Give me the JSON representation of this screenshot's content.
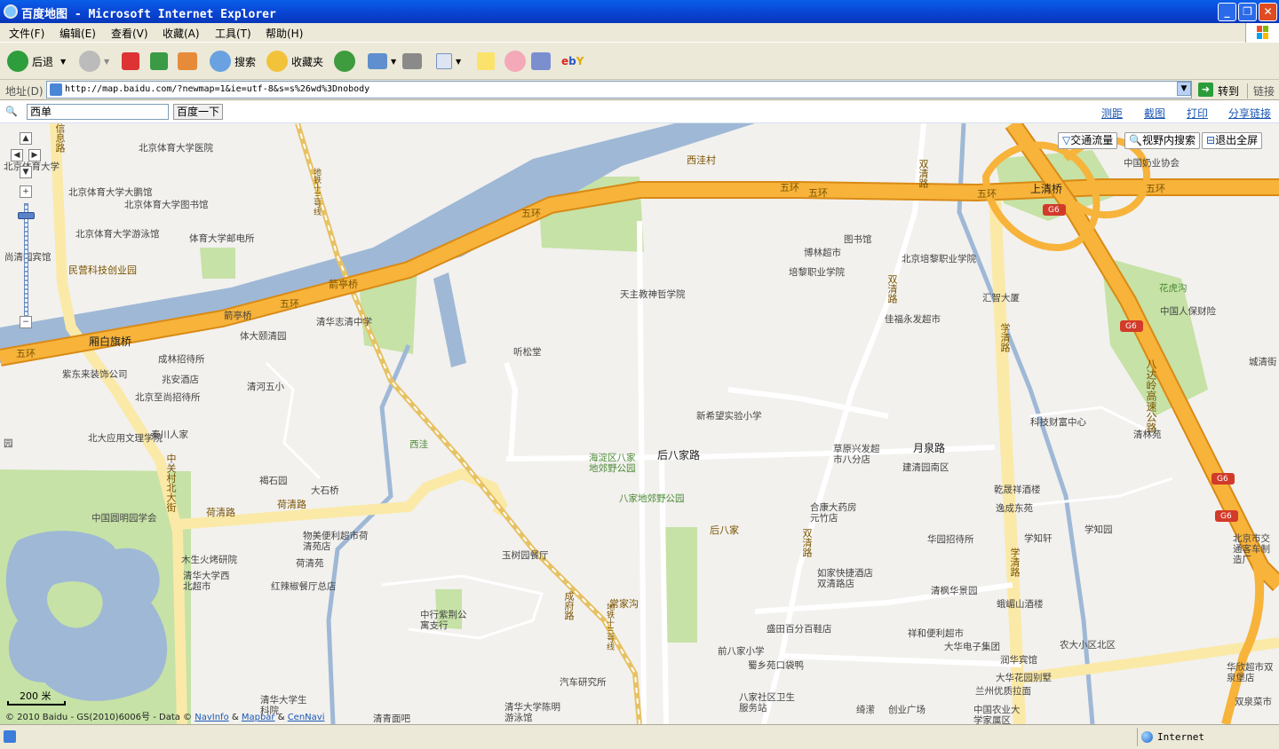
{
  "window": {
    "title": "百度地图 - Microsoft Internet Explorer",
    "minimize": "_",
    "restore": "❐",
    "close": "✕"
  },
  "menu": [
    "文件(F)",
    "编辑(E)",
    "查看(V)",
    "收藏(A)",
    "工具(T)",
    "帮助(H)"
  ],
  "toolbar": {
    "back": "后退",
    "search": "搜索",
    "favorites": "收藏夹"
  },
  "address": {
    "label": "地址(D)",
    "url": "http://map.baidu.com/?newmap=1&ie=utf-8&s=s%26wd%3Dnobody",
    "go": "转到",
    "links": "链接"
  },
  "mapsearch": {
    "query": "西单",
    "button": "百度一下",
    "links": [
      "测距",
      "截图",
      "打印",
      "分享链接"
    ]
  },
  "map_controls": {
    "traffic": "交通流量",
    "view_search": "视野内搜索",
    "exit_fullscreen": "退出全屏",
    "scale": "200 米",
    "copyright_prefix": "© 2010 Baidu - GS(2010)6006号 - Data ©",
    "navinfo": "NavInfo",
    "mapbar": "Mapbar",
    "citnavi": "CenNavi"
  },
  "road_labels": {
    "wuhuan": "五环",
    "shangqingqiao": "上清桥",
    "shuangqinglu": "双清路",
    "jianqiao": "箭亭桥",
    "xiangbaiqiqiao": "厢白旗桥",
    "heqinglu": "荷清路",
    "zhongguancun": "中关村北大街",
    "xinxilu": "信息路",
    "xueqinglu": "学清路",
    "yuequanlu": "月泉路",
    "houbajialu": "后八家路",
    "chengfulu": "成府路",
    "badaling": "八达岭高速公路",
    "g6": "G6",
    "railway_north": "地铁十三号线",
    "railway_south": "地铁十三号线"
  },
  "places": [
    "北京体育大学医院",
    "北京体育大学",
    "北京体育大学大鹏馆",
    "北京体育大学图书馆",
    "北京体育大学游泳馆",
    "体育大学邮电所",
    "尚清园宾馆",
    "民营科技创业园",
    "西洼村",
    "五环",
    "图书馆",
    "博林超市",
    "北京培黎职业学院",
    "培黎职业学院",
    "天主教神哲学院",
    "佳福永发超市",
    "汇智大厦",
    "中国奶业协会",
    "花虎沟",
    "中国人保财险",
    "城清街",
    "箭亭桥",
    "清华志清中学",
    "体大颐清园",
    "成林招待所",
    "紫东来装饰公司",
    "兆安酒店",
    "清河五小",
    "北京至尚招待所",
    "听松堂",
    "新希望实验小学",
    "科技财富中心",
    "清林苑",
    "北大应用文理学院",
    "秦川人家",
    "西洼",
    "海淀区八家地郊野公园",
    "草原兴发超市八分店",
    "建清园南区",
    "褐石园",
    "大石桥",
    "八家地郊野公园",
    "中国圆明园学会",
    "合康大药房元竹店",
    "乾晟祥酒楼",
    "逸成东苑",
    "后八家",
    "物美便利超市荷清苑店",
    "华园招待所",
    "学知轩",
    "学知园",
    "北京市交通客车制造厂",
    "木生火烤研院",
    "玉树园餐厅",
    "荷清苑",
    "清华大学西北超市",
    "红辣椒餐厅总店",
    "如家快捷酒店双清路店",
    "清枫华景园",
    "常家沟",
    "蛾嵋山酒楼",
    "中行紫荆公寓支行",
    "盛田百分百鞋店",
    "祥和便利超市",
    "大华电子集团",
    "农大小区北区",
    "前八家小学",
    "蜀乡苑口袋鸭",
    "润华宾馆",
    "华欣超市双泉堡店",
    "汽车研究所",
    "大华花园别墅",
    "兰州优质拉面",
    "清华大学生科院",
    "八家社区卫生服务站",
    "清华大学陈明游泳馆",
    "绮潆",
    "创业广场",
    "中国农业大学家属区",
    "双泉菜市",
    "清青面吧",
    "园"
  ],
  "status": {
    "zone": "Internet"
  },
  "colors": {
    "expressway": "#f7b33a",
    "water": "#9fb8d6",
    "park": "#c6e2a6",
    "road": "#ffffff",
    "secondary_road": "#fbe9a8"
  }
}
